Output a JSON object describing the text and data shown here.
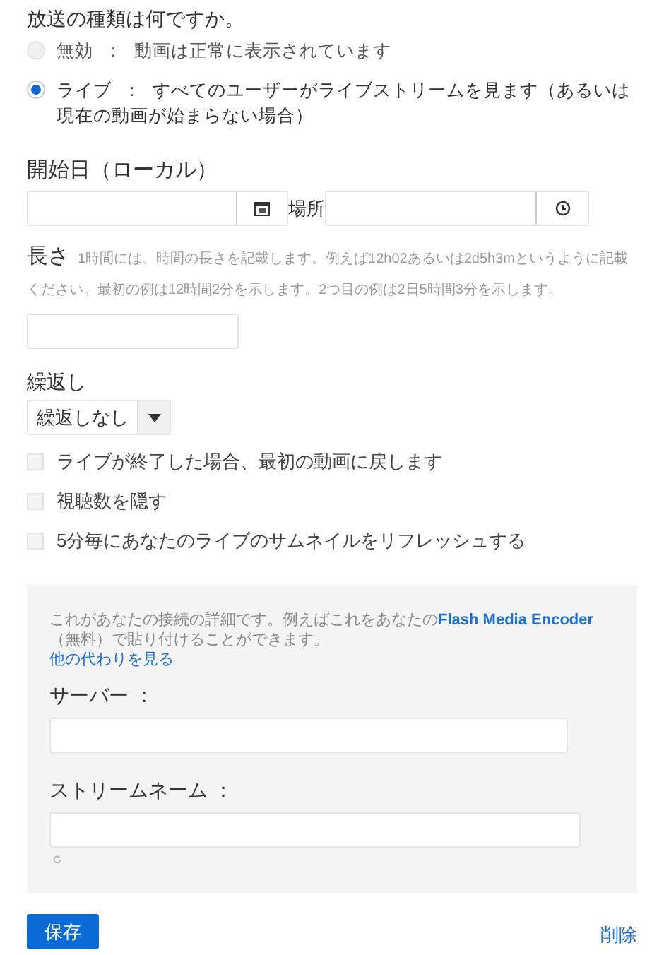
{
  "broadcast_type": {
    "title": "放送の種類は何ですか。",
    "options": [
      {
        "name": "無効",
        "separator": "：",
        "description": "動画は正常に表示されています",
        "selected": false
      },
      {
        "name": "ライブ",
        "separator": "：",
        "description": "すべてのユーザーがライブストリームを見ます（あるいは現在の動画が始まらない場合）",
        "selected": true
      }
    ]
  },
  "start_date": {
    "label": "開始日（ローカル）",
    "place_label": "場所"
  },
  "duration": {
    "label": "長さ",
    "hint": "1時間には、時間の長さを記載します。例えば12h02あるいは2d5h3mというように記載ください。最初の例は12時間2分を示します。2つ目の例は2日5時間3分を示します。"
  },
  "repeat": {
    "label": "繰返し",
    "value": "繰返しなし"
  },
  "options": [
    {
      "label": "ライブが終了した場合、最初の動画に戻します",
      "checked": false
    },
    {
      "label": "視聴数を隠す",
      "checked": false
    },
    {
      "label": "5分毎にあなたのライブのサムネイルをリフレッシュする",
      "checked": false
    }
  ],
  "connection": {
    "intro_before": "これがあなたの接続の詳細です。例えばこれをあなたの",
    "intro_link": "Flash Media Encoder",
    "intro_after": "（無料）で貼り付けることができます。",
    "alternatives_link": "他の代わりを見る",
    "server_label": "サーバー ：",
    "stream_label": "ストリームネーム ："
  },
  "buttons": {
    "save": "保存",
    "delete": "削除"
  }
}
